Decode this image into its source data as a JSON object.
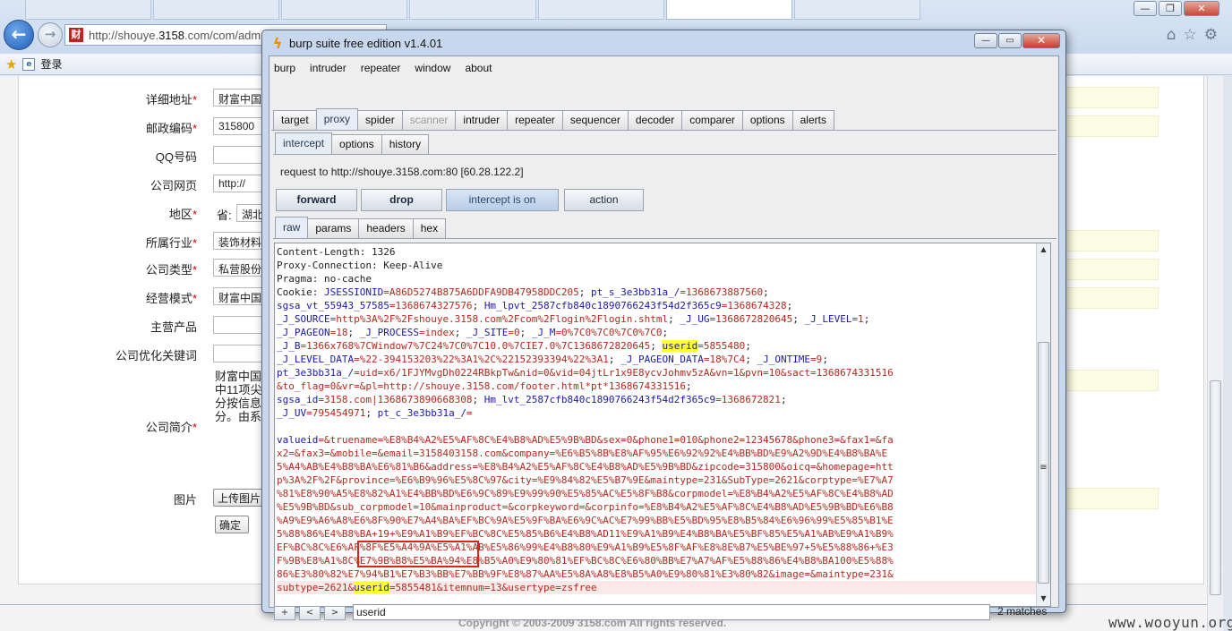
{
  "browser": {
    "address": {
      "prefix": "http://shouye.",
      "domain": "3158",
      "suffix": ".com/com/adm"
    },
    "favicon_text": "财",
    "favorites": {
      "login_label": "登录"
    },
    "win_buttons": {
      "minimize": "—",
      "maximize": "❐",
      "close": "✕"
    },
    "right_icons": {
      "home": "⌂",
      "star": "☆",
      "gear": "⚙"
    }
  },
  "webpage": {
    "fields": [
      {
        "label": "详细地址",
        "required": "*",
        "value": "财富中国"
      },
      {
        "label": "邮政编码",
        "required": "*",
        "value": "315800"
      },
      {
        "label": "QQ号码",
        "required": "",
        "value": ""
      },
      {
        "label": "公司网页",
        "required": "",
        "value": "http://"
      },
      {
        "label": "地区",
        "required": "*",
        "value": "湖北"
      },
      {
        "label": "所属行业",
        "required": "*",
        "value": "装饰材料"
      },
      {
        "label": "公司类型",
        "required": "*",
        "value": "私营股份"
      },
      {
        "label": "经营模式",
        "required": "*",
        "value": "财富中国"
      },
      {
        "label": "主营产品",
        "required": "",
        "value": ""
      },
      {
        "label": "公司优化关键词",
        "required": "",
        "value": ""
      },
      {
        "label": "公司简介",
        "required": "*",
        "value": ""
      },
      {
        "label": "图片",
        "required": "",
        "value": ""
      }
    ],
    "province_label": "省:",
    "intro_text": "财富中国中11项尖分按信息分。由系",
    "upload_button": "上传图片",
    "confirm_button": "确定",
    "footer": "Copyright © 2003-2009 3158.com All rights reserved."
  },
  "watermark": "www.wooyun.org",
  "burp": {
    "title": "burp suite free edition v1.4.01",
    "controls": {
      "minimize": "—",
      "maximize": "▭",
      "close": "✕"
    },
    "menu": [
      "burp",
      "intruder",
      "repeater",
      "window",
      "about"
    ],
    "main_tabs": [
      "target",
      "proxy",
      "spider",
      "scanner",
      "intruder",
      "repeater",
      "sequencer",
      "decoder",
      "comparer",
      "options",
      "alerts"
    ],
    "proxy_tabs": [
      "intercept",
      "options",
      "history"
    ],
    "request_info": "request to http://shouye.3158.com:80  [60.28.122.2]",
    "buttons": {
      "forward": "forward",
      "drop": "drop",
      "intercept": "intercept is on",
      "action": "action"
    },
    "view_tabs": [
      "raw",
      "params",
      "headers",
      "hex"
    ],
    "request_lines": [
      [
        {
          "t": "Content-Length: 1326",
          "c": "k"
        }
      ],
      [
        {
          "t": "Proxy-Connection: Keep-Alive",
          "c": "k"
        }
      ],
      [
        {
          "t": "Pragma: no-cache",
          "c": "k"
        }
      ],
      [
        {
          "t": "Cookie: ",
          "c": "k"
        },
        {
          "t": "JSESSIONID",
          "c": "n"
        },
        {
          "t": "=A86D5274B875A6DDFA9DB47958DDC205",
          "c": "v"
        },
        {
          "t": "; ",
          "c": "k"
        },
        {
          "t": "pt_s_3e3bb31a_/",
          "c": "n"
        },
        {
          "t": "=1368673887560",
          "c": "v"
        },
        {
          "t": ";",
          "c": "k"
        }
      ],
      [
        {
          "t": "sgsa_vt_55943_57585",
          "c": "n"
        },
        {
          "t": "=1368674327576",
          "c": "v"
        },
        {
          "t": "; ",
          "c": "k"
        },
        {
          "t": "Hm_lpvt_2587cfb840c1890766243f54d2f365c9",
          "c": "n"
        },
        {
          "t": "=1368674328",
          "c": "v"
        },
        {
          "t": ";",
          "c": "k"
        }
      ],
      [
        {
          "t": "_J_SOURCE",
          "c": "n"
        },
        {
          "t": "=http%3A%2F%2Fshouye.3158.com%2Fcom%2Flogin%2Flogin.shtml",
          "c": "v"
        },
        {
          "t": "; ",
          "c": "k"
        },
        {
          "t": "_J_UG",
          "c": "n"
        },
        {
          "t": "=1368672820645",
          "c": "v"
        },
        {
          "t": "; ",
          "c": "k"
        },
        {
          "t": "_J_LEVEL",
          "c": "n"
        },
        {
          "t": "=1",
          "c": "v"
        },
        {
          "t": ";",
          "c": "k"
        }
      ],
      [
        {
          "t": "_J_PAGEON",
          "c": "n"
        },
        {
          "t": "=18",
          "c": "v"
        },
        {
          "t": "; ",
          "c": "k"
        },
        {
          "t": "_J_PROCESS",
          "c": "n"
        },
        {
          "t": "=index",
          "c": "v"
        },
        {
          "t": "; ",
          "c": "k"
        },
        {
          "t": "_J_SITE",
          "c": "n"
        },
        {
          "t": "=0",
          "c": "v"
        },
        {
          "t": "; ",
          "c": "k"
        },
        {
          "t": "_J_M",
          "c": "n"
        },
        {
          "t": "=0%7C0%7C0%7C0%7C0",
          "c": "v"
        },
        {
          "t": ";",
          "c": "k"
        }
      ],
      [
        {
          "t": "_J_B",
          "c": "n"
        },
        {
          "t": "=1366x768%7CWindow7%7C24%7C0%7C10.0%7CIE7.0%7C1368672820645",
          "c": "v"
        },
        {
          "t": "; ",
          "c": "k"
        },
        {
          "t": "userid",
          "c": "hl"
        },
        {
          "t": "=5855480",
          "c": "v"
        },
        {
          "t": ";",
          "c": "k"
        }
      ],
      [
        {
          "t": "_J_LEVEL_DATA",
          "c": "n"
        },
        {
          "t": "=%22-394153203%22%3A1%2C%22152393394%22%3A1",
          "c": "v"
        },
        {
          "t": "; ",
          "c": "k"
        },
        {
          "t": "_J_PAGEON_DATA",
          "c": "n"
        },
        {
          "t": "=18%7C4",
          "c": "v"
        },
        {
          "t": "; ",
          "c": "k"
        },
        {
          "t": "_J_ONTIME",
          "c": "n"
        },
        {
          "t": "=9",
          "c": "v"
        },
        {
          "t": ";",
          "c": "k"
        }
      ],
      [
        {
          "t": "pt_3e3bb31a_/",
          "c": "n"
        },
        {
          "t": "=uid=x6/1FJYMvgDh0224RBkpTw&nid=0&vid=04jtLr1x9E8ycvJohmv5zA&vn=1&pvn=10&sact=1368674331516",
          "c": "v"
        }
      ],
      [
        {
          "t": "&to_flag=0&vr=&pl=http://shouye.3158.com/footer.html*pt*1368674331516",
          "c": "v"
        },
        {
          "t": ";",
          "c": "k"
        }
      ],
      [
        {
          "t": "sgsa_id",
          "c": "n"
        },
        {
          "t": "=3158.com|1368673890668308",
          "c": "v"
        },
        {
          "t": "; ",
          "c": "k"
        },
        {
          "t": "Hm_lvt_2587cfb840c1890766243f54d2f365c9",
          "c": "n"
        },
        {
          "t": "=1368672821",
          "c": "v"
        },
        {
          "t": ";",
          "c": "k"
        }
      ],
      [
        {
          "t": "_J_UV",
          "c": "n"
        },
        {
          "t": "=795454971",
          "c": "v"
        },
        {
          "t": "; ",
          "c": "k"
        },
        {
          "t": "pt_c_3e3bb31a_/",
          "c": "n"
        },
        {
          "t": "=",
          "c": "v"
        }
      ],
      [
        {
          "t": "",
          "c": "k"
        }
      ],
      [
        {
          "t": "valueid",
          "c": "n"
        },
        {
          "t": "=&truename=%E8%B4%A2%E5%AF%8C%E4%B8%AD%E5%9B%BD&sex=0&phone1=010&phone2=12345678&phone3=&fax1=&fa",
          "c": "v"
        }
      ],
      [
        {
          "t": "x2=&fax3=&mobile=&email=3158403158.com&company=%E6%B5%8B%E8%AF%95%E6%92%92%E4%BB%BD%E9%A2%9D%E4%B8%BA%E",
          "c": "v"
        }
      ],
      [
        {
          "t": "5%A4%AB%E4%B8%BA%E6%81%B6&address=%E8%B4%A2%E5%AF%8C%E4%B8%AD%E5%9B%BD&zipcode=315800&oicq=&homepage=htt",
          "c": "v"
        }
      ],
      [
        {
          "t": "p%3A%2F%2F&province=%E6%B9%96%E5%8C%97&city=%E9%84%82%E5%B7%9E&maintype=231&SubType=2621&corptype=%E7%A7",
          "c": "v"
        }
      ],
      [
        {
          "t": "%81%E8%90%A5%E8%82%A1%E4%BB%BD%E6%9C%89%E9%99%90%E5%85%AC%E5%8F%B8&corpmodel=%E8%B4%A2%E5%AF%8C%E4%B8%AD",
          "c": "v"
        }
      ],
      [
        {
          "t": "%E5%9B%BD&sub_corpmodel=10&mainproduct=&corpkeyword=&corpinfo=%E8%B4%A2%E5%AF%8C%E4%B8%AD%E5%9B%BD%E6%B8",
          "c": "v"
        }
      ],
      [
        {
          "t": "%A9%E9%A6%A8%E6%8F%90%E7%A4%BA%EF%BC%9A%E5%9F%BA%E6%9C%AC%E7%99%BB%E5%BD%95%E8%B5%84%E6%96%99%E5%85%B1%E",
          "c": "v"
        }
      ],
      [
        {
          "t": "5%88%86%E4%B8%BA+19+%E9%A1%B9%EF%BC%8C%E5%85%B6%E4%B8%AD11%E9%A1%B9%E4%B8%BA%E5%BF%85%E5%A1%AB%E9%A1%B9%",
          "c": "v"
        }
      ],
      [
        {
          "t": "EF%BC%8C%E6%AF%8F%E5%A4%9A%E5%A1%AB%E5%86%99%E4%B8%80%E9%A1%B9%E5%8F%AF%E8%8E%B7%E5%BE%97+5%E5%88%86+%E3",
          "c": "v"
        }
      ],
      [
        {
          "t": "F%9B%E8%A1%8C%E7%9B%B8%E5%BA%94%E8%B5%A0%E9%80%81%EF%BC%8C%E6%80%BB%E7%A7%AF%E5%88%86%E4%B8%BA100%E5%88%",
          "c": "v"
        }
      ],
      [
        {
          "t": "86%E3%80%82%E7%94%B1%E7%B3%BB%E7%BB%9F%E8%87%AA%E5%8A%A8%E8%B5%A0%E9%80%81%E3%80%82&image=&maintype=231&",
          "c": "v"
        }
      ],
      [
        {
          "t": "subtype=2621&",
          "c": "v"
        },
        {
          "t": "userid",
          "c": "hl"
        },
        {
          "t": "=5855481&itemnum=13&usertype=zsfree",
          "c": "v"
        }
      ]
    ],
    "search": {
      "prev": "+",
      "back": "<",
      "next": ">",
      "query": "userid",
      "matches": "2 matches"
    },
    "scroll": {
      "up": "▲",
      "down": "▼",
      "grip": "≡"
    }
  }
}
